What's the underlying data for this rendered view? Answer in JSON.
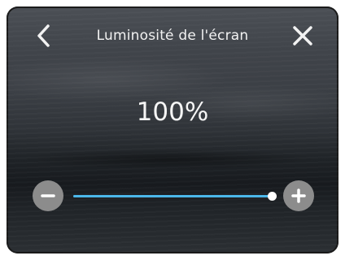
{
  "header": {
    "title": "Luminosité de l'écran",
    "back_icon": "chevron-left-icon",
    "close_icon": "close-icon"
  },
  "brightness": {
    "value_label": "100%",
    "level": 1.0
  },
  "slider": {
    "decrease_icon": "minus-icon",
    "increase_icon": "plus-icon",
    "accent_color": "#4bb7ea"
  }
}
